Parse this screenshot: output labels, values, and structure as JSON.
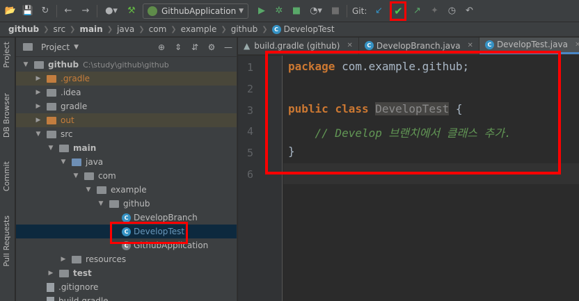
{
  "toolbar": {
    "run_config": "GithubApplication",
    "git_label": "Git:",
    "icons": [
      "open-folder-icon",
      "save-icon",
      "sync-icon",
      "back-icon",
      "forward-icon",
      "user-icon",
      "build-hammer-icon",
      "run-icon",
      "debug-icon",
      "coverage-icon",
      "more-run-icon",
      "stop-icon",
      "git-update-icon",
      "git-commit-check-icon",
      "git-push-icon",
      "git-merge-icon",
      "history-icon",
      "rollback-icon"
    ],
    "accent_highlight": "#ff0000",
    "check_color": "#4ec94e"
  },
  "breadcrumb": {
    "items": [
      "github",
      "src",
      "main",
      "java",
      "com",
      "example",
      "github",
      "DevelopTest"
    ]
  },
  "left_strip": {
    "tabs": [
      "Project",
      "DB Browser",
      "Commit",
      "Pull Requests"
    ]
  },
  "project_panel": {
    "title": "Project",
    "tree": [
      {
        "name": "github",
        "path": "C:\\study\\github\\github",
        "level": 0,
        "expanded": true,
        "bold": true,
        "kind": "folder"
      },
      {
        "name": ".gradle",
        "level": 1,
        "expanded": false,
        "kind": "folder-orange",
        "highlight": true
      },
      {
        "name": ".idea",
        "level": 1,
        "expanded": false,
        "kind": "folder"
      },
      {
        "name": "gradle",
        "level": 1,
        "expanded": false,
        "kind": "folder"
      },
      {
        "name": "out",
        "level": 1,
        "expanded": false,
        "kind": "folder-orange",
        "highlight": true
      },
      {
        "name": "src",
        "level": 1,
        "expanded": true,
        "kind": "folder"
      },
      {
        "name": "main",
        "level": 2,
        "expanded": true,
        "bold": true,
        "kind": "folder"
      },
      {
        "name": "java",
        "level": 3,
        "expanded": true,
        "kind": "folder-blue"
      },
      {
        "name": "com",
        "level": 4,
        "expanded": true,
        "kind": "package"
      },
      {
        "name": "example",
        "level": 5,
        "expanded": true,
        "kind": "package"
      },
      {
        "name": "github",
        "level": 6,
        "expanded": true,
        "kind": "package"
      },
      {
        "name": "DevelopBranch",
        "level": 7,
        "kind": "class"
      },
      {
        "name": "DevelopTest",
        "level": 7,
        "kind": "class",
        "selected": true
      },
      {
        "name": "GithubApplication",
        "level": 7,
        "kind": "class-app"
      },
      {
        "name": "resources",
        "level": 3,
        "expanded": false,
        "kind": "folder"
      },
      {
        "name": "test",
        "level": 2,
        "expanded": false,
        "bold": true,
        "kind": "folder"
      },
      {
        "name": ".gitignore",
        "level": 1,
        "kind": "file"
      },
      {
        "name": "build.gradle",
        "level": 1,
        "kind": "file"
      }
    ]
  },
  "editor": {
    "tabs": [
      {
        "label": "build.gradle (github)",
        "active": false
      },
      {
        "label": "DevelopBranch.java",
        "active": false
      },
      {
        "label": "DevelopTest.java",
        "active": true
      }
    ],
    "line_numbers": [
      "1",
      "2",
      "3",
      "4",
      "5",
      "6"
    ],
    "code": {
      "l1_kw": "package",
      "l1_rest": " com.example.github;",
      "l3_kw1": "public",
      "l3_kw2": "class",
      "l3_cls": "DevelopTest",
      "l3_brace": " {",
      "l4_comment": "    // Develop 브랜치에서 클래스 추가.",
      "l5_brace": "}"
    }
  }
}
